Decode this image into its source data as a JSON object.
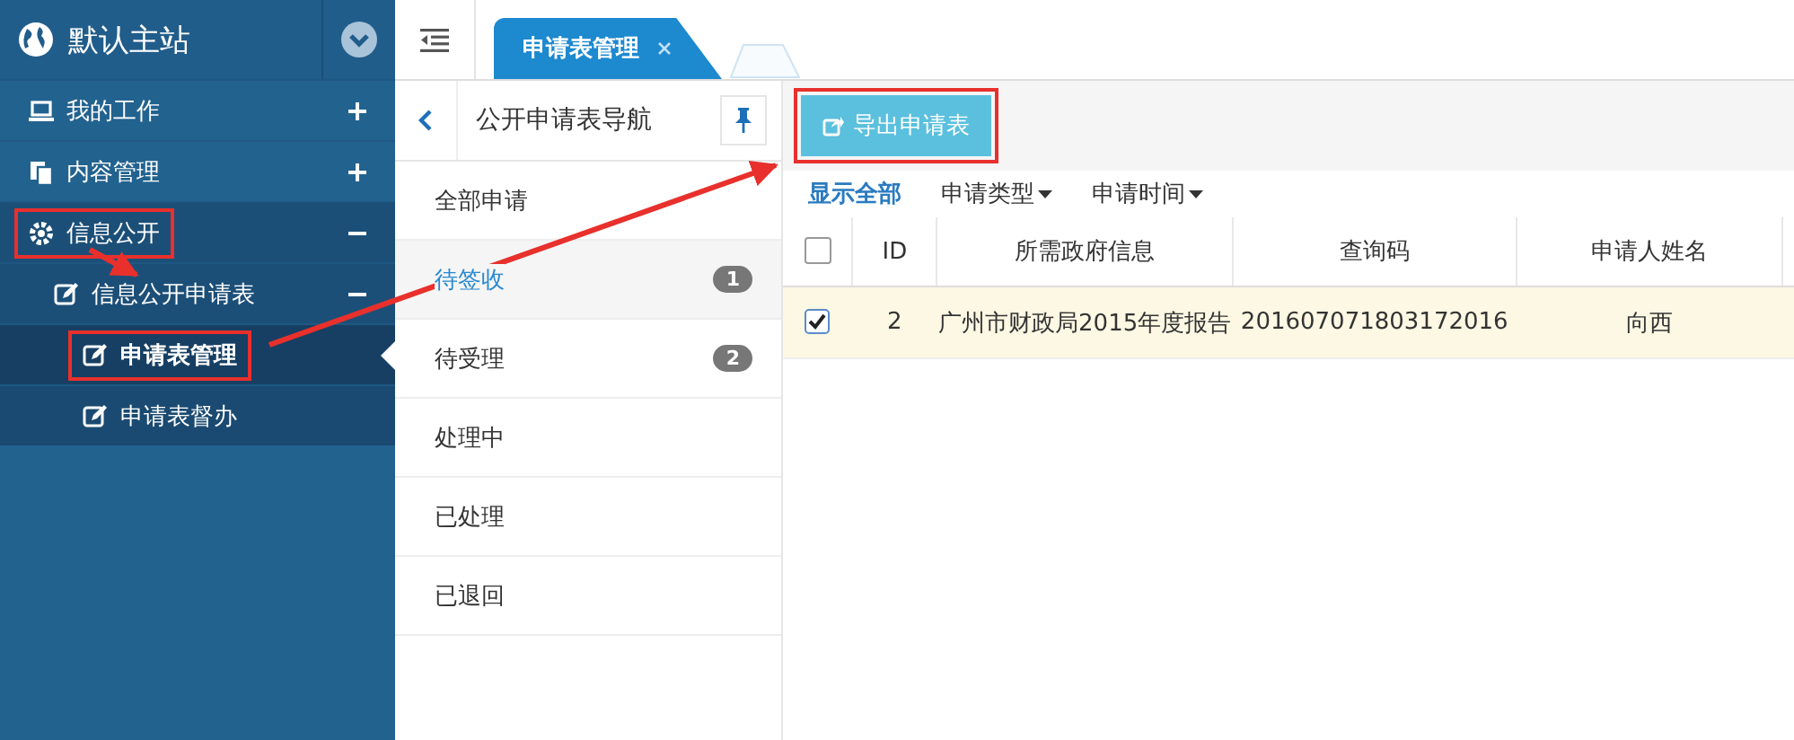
{
  "site": {
    "title": "默认主站"
  },
  "menu": [
    {
      "label": "我的工作",
      "expanded": false,
      "highlighted": false
    },
    {
      "label": "内容管理",
      "expanded": false,
      "highlighted": false
    },
    {
      "label": "信息公开",
      "expanded": true,
      "highlighted": true,
      "children": [
        {
          "label": "信息公开申请表",
          "expanded": true,
          "highlighted": false,
          "children": [
            {
              "label": "申请表管理",
              "selected": true,
              "highlighted": true
            },
            {
              "label": "申请表督办",
              "selected": false,
              "highlighted": false
            }
          ]
        }
      ]
    }
  ],
  "tabs": [
    {
      "label": "申请表管理",
      "selected": true
    }
  ],
  "nav": {
    "title": "公开申请表导航",
    "items": [
      {
        "label": "全部申请",
        "selected": false
      },
      {
        "label": "待签收",
        "selected": true,
        "badge": "1"
      },
      {
        "label": "待受理",
        "selected": false,
        "badge": "2"
      },
      {
        "label": "处理中",
        "selected": false
      },
      {
        "label": "已处理",
        "selected": false
      },
      {
        "label": "已退回",
        "selected": false
      }
    ]
  },
  "toolbar": {
    "export_button": {
      "label": "导出申请表",
      "highlighted": true
    }
  },
  "filters": [
    {
      "label": "显示全部",
      "kind": "link"
    },
    {
      "label": "申请类型",
      "kind": "dropdown"
    },
    {
      "label": "申请时间",
      "kind": "dropdown"
    }
  ],
  "table": {
    "select_all": false,
    "columns": [
      "ID",
      "所需政府信息",
      "查询码",
      "申请人姓名"
    ],
    "rows": [
      {
        "selected": true,
        "cells": [
          "2",
          "广州市财政局2015年度报告",
          "20160707180317​2016",
          "向西"
        ]
      }
    ]
  }
}
